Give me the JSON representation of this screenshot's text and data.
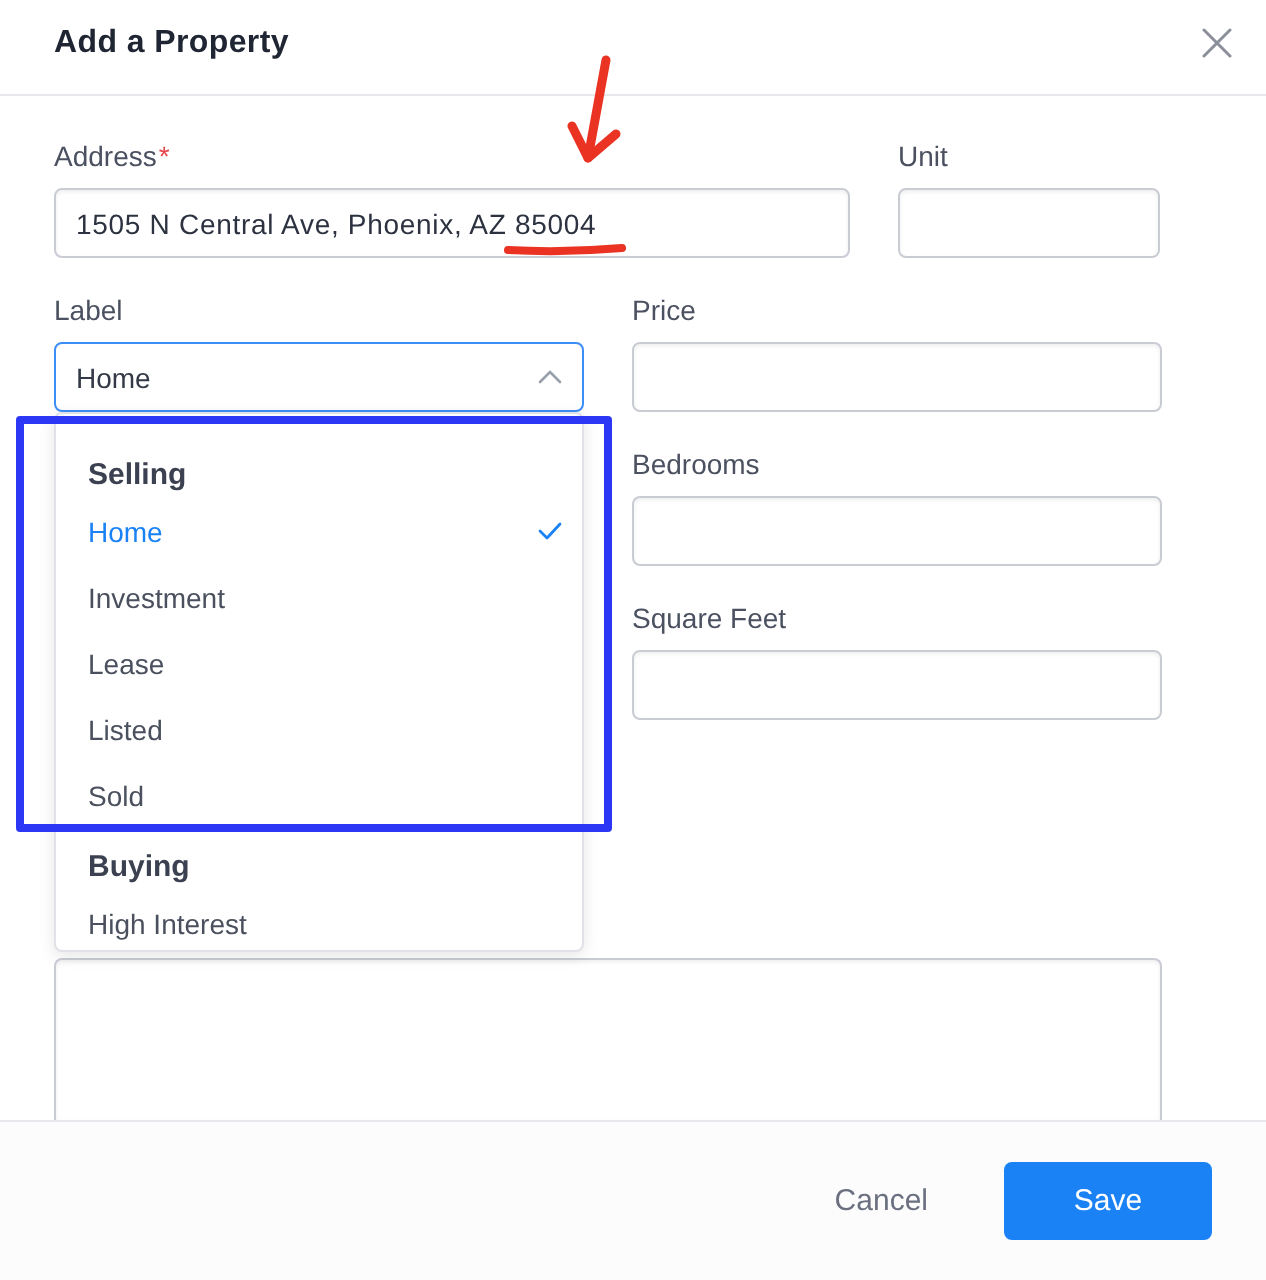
{
  "dialog": {
    "title": "Add a Property"
  },
  "address": {
    "label": "Address",
    "required_mark": "*",
    "value": "1505 N Central Ave, Phoenix, AZ 85004"
  },
  "unit": {
    "label": "Unit"
  },
  "label_select": {
    "label": "Label",
    "value": "Home",
    "expanded": true,
    "groups": [
      {
        "heading": "Selling",
        "options": [
          {
            "label": "Home",
            "selected": true
          },
          {
            "label": "Investment",
            "selected": false
          },
          {
            "label": "Lease",
            "selected": false
          },
          {
            "label": "Listed",
            "selected": false
          },
          {
            "label": "Sold",
            "selected": false
          }
        ]
      },
      {
        "heading": "Buying",
        "options": [
          {
            "label": "High Interest",
            "selected": false
          }
        ]
      }
    ]
  },
  "price": {
    "label": "Price"
  },
  "bedrooms": {
    "label": "Bedrooms"
  },
  "square_feet": {
    "label": "Square Feet"
  },
  "footer": {
    "buttons": [
      {
        "label": "Cancel",
        "kind": "secondary"
      },
      {
        "label": "Save",
        "kind": "primary"
      }
    ]
  },
  "annotations": [
    {
      "kind": "arrow",
      "color": "#ea3323"
    },
    {
      "kind": "underline",
      "color": "#ea3323"
    },
    {
      "kind": "frame",
      "color": "#2b37f5"
    }
  ]
}
